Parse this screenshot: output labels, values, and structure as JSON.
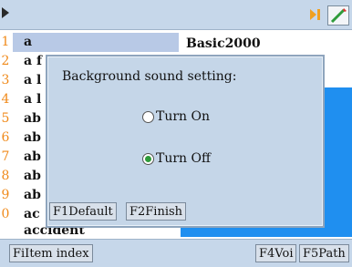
{
  "top_bar": {
    "icons": [
      "cursor-arrow-icon",
      "play-icon",
      "edit-pen-icon"
    ]
  },
  "word_list": {
    "rows": [
      {
        "num": "1",
        "word": "a",
        "selected": true
      },
      {
        "num": "2",
        "word": "a f"
      },
      {
        "num": "3",
        "word": "a l"
      },
      {
        "num": "4",
        "word": "a l"
      },
      {
        "num": "5",
        "word": "ab"
      },
      {
        "num": "6",
        "word": "ab"
      },
      {
        "num": "7",
        "word": "ab"
      },
      {
        "num": "8",
        "word": "ab"
      },
      {
        "num": "9",
        "word": "ab"
      },
      {
        "num": "0",
        "word": "ac"
      },
      {
        "num": "",
        "word": "accident"
      }
    ]
  },
  "right_panel": {
    "title": "Basic2000"
  },
  "dialog": {
    "title": "Background sound setting:",
    "options": [
      {
        "label": "Turn On",
        "checked": false
      },
      {
        "label": "Turn Off",
        "checked": true
      }
    ],
    "buttons": {
      "default": "F1Default",
      "finish": "F2Finish"
    }
  },
  "bottom_bar": {
    "item_index": "FiItem index",
    "voice": "F4Voi",
    "path": "F5Path"
  },
  "colors": {
    "panel": "#c6d7ea",
    "selection": "#b8c9e6",
    "accent_blue": "#1f8ff0",
    "number": "#f08a1a",
    "radio_checked": "#2e9b3a"
  }
}
